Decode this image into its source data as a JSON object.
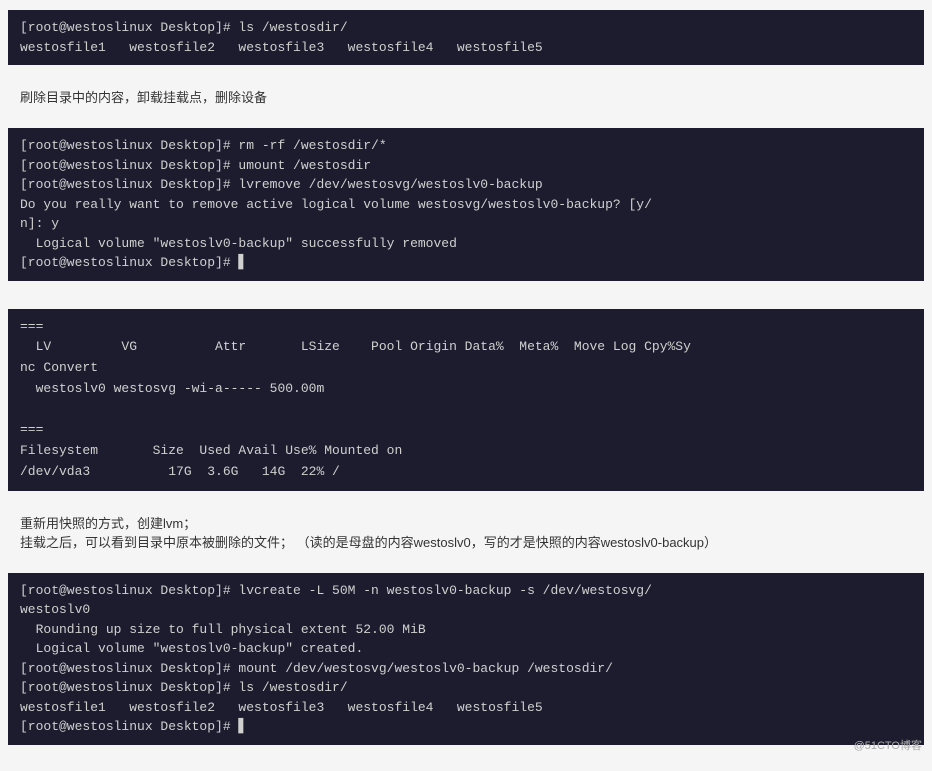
{
  "blocks": {
    "terminal1": {
      "lines": [
        "[root@westoslinux Desktop]# ls /westosdir/",
        "westosfile1   westosfile2   westosfile3   westosfile4   westosfile5"
      ]
    },
    "annotation1": "刷除目录中的内容，卸载挂载点，删除设备",
    "terminal2": {
      "lines": [
        "[root@westoslinux Desktop]# rm -rf /westosdir/*",
        "[root@westoslinux Desktop]# umount /westosdir",
        "[root@westoslinux Desktop]# lvremove /dev/westosvg/westoslv0-backup",
        "Do you really want to remove active logical volume westosvg/westoslv0-backup? [y/",
        "n]: y",
        "  Logical volume \"westoslv0-backup\" successfully removed",
        "[root@westoslinux Desktop]# ▋"
      ]
    },
    "terminal3": {
      "lines": [
        "===",
        "  LV         VG          Attr       LSize    Pool Origin Data%  Meta%  Move Log Cpy%Sy",
        "nc Convert",
        "  westoslv0 westosvg -wi-a----- 500.00m",
        "",
        "===",
        "Filesystem       Size  Used Avail Use% Mounted on",
        "/dev/vda3          17G  3.6G   14G  22% /"
      ]
    },
    "annotation2a": "重新用快照的方式，创建lvm；",
    "annotation2b": "挂载之后，可以看到目录中原本被删除的文件；  （读的是母盘的内容westoslv0，写的才是快照的内容westoslv0-backup）",
    "terminal4": {
      "lines": [
        "[root@westoslinux Desktop]# lvcreate -L 50M -n westoslv0-backup -s /dev/westosvg/",
        "westoslv0",
        "  Rounding up size to full physical extent 52.00 MiB",
        "  Logical volume \"westoslv0-backup\" created.",
        "[root@westoslinux Desktop]# mount /dev/westosvg/westoslv0-backup /westosdir/",
        "[root@westoslinux Desktop]# ls /westosdir/",
        "westosfile1   westosfile2   westosfile3   westosfile4   westosfile5",
        "[root@westoslinux Desktop]# ▋"
      ]
    },
    "watermark": "@51CTO博客"
  }
}
